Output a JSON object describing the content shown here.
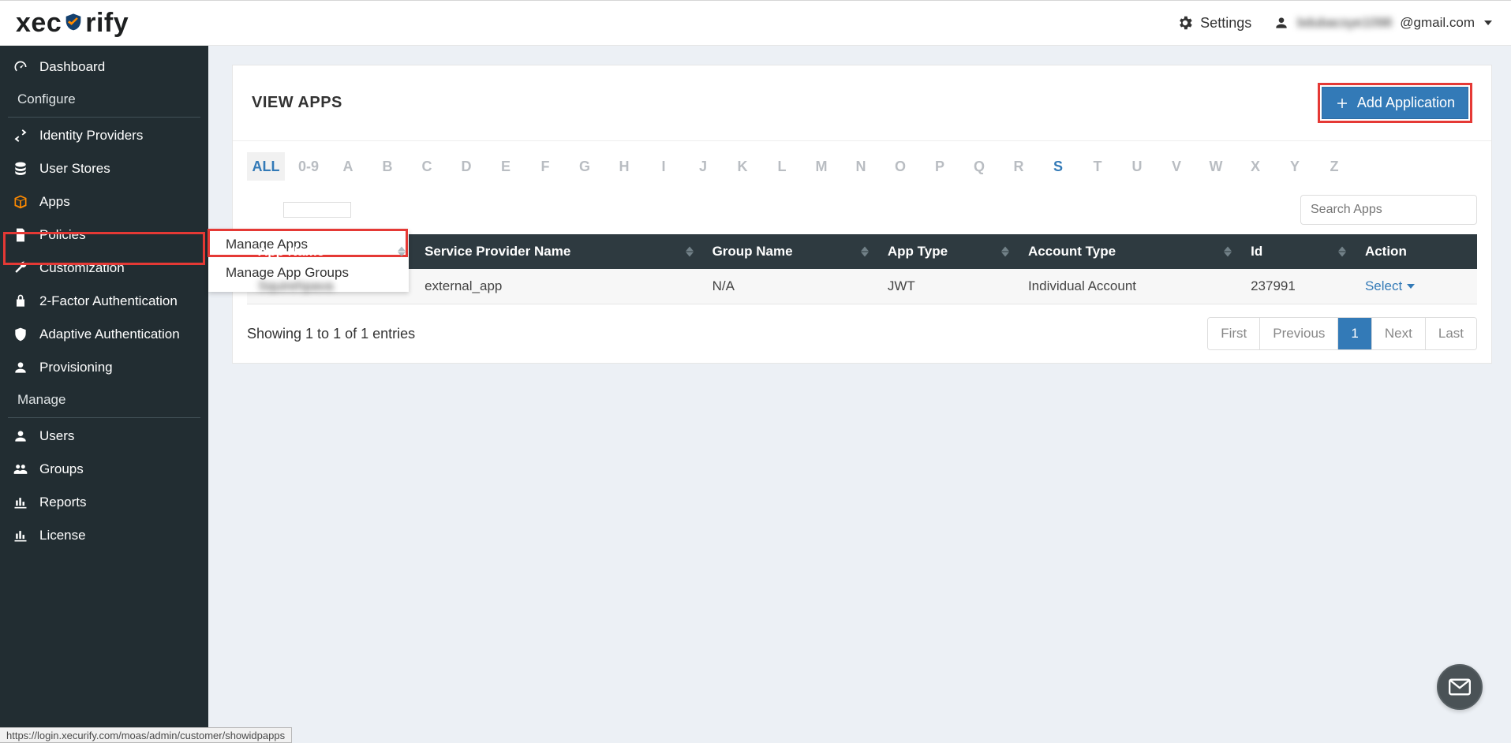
{
  "header": {
    "logo_left": "xec",
    "logo_right": "rify",
    "settings_label": "Settings",
    "user_email_masked": "bdubacsye1098",
    "user_email_suffix": "@gmail.com"
  },
  "sidebar": {
    "items_top": [
      {
        "name": "dashboard",
        "label": "Dashboard",
        "icon": "gauge"
      }
    ],
    "section_configure": "Configure",
    "items_configure": [
      {
        "name": "identity-providers",
        "label": "Identity Providers",
        "icon": "swap"
      },
      {
        "name": "user-stores",
        "label": "User Stores",
        "icon": "db"
      },
      {
        "name": "apps",
        "label": "Apps",
        "icon": "box",
        "active": true
      },
      {
        "name": "policies",
        "label": "Policies",
        "icon": "doc"
      },
      {
        "name": "customization",
        "label": "Customization",
        "icon": "wrench"
      },
      {
        "name": "two-factor",
        "label": "2-Factor Authentication",
        "icon": "lock"
      },
      {
        "name": "adaptive-auth",
        "label": "Adaptive Authentication",
        "icon": "shield"
      },
      {
        "name": "provisioning",
        "label": "Provisioning",
        "icon": "person"
      }
    ],
    "section_manage": "Manage",
    "items_manage": [
      {
        "name": "users",
        "label": "Users",
        "icon": "person"
      },
      {
        "name": "groups",
        "label": "Groups",
        "icon": "group"
      },
      {
        "name": "reports",
        "label": "Reports",
        "icon": "chart"
      },
      {
        "name": "license",
        "label": "License",
        "icon": "chart"
      }
    ],
    "submenu": {
      "manage_apps": "Manage Apps",
      "manage_app_groups": "Manage App Groups"
    }
  },
  "main": {
    "title": "VIEW APPS",
    "add_button": "Add Application",
    "letter_filter": [
      "ALL",
      "0-9",
      "A",
      "B",
      "C",
      "D",
      "E",
      "F",
      "G",
      "H",
      "I",
      "J",
      "K",
      "L",
      "M",
      "N",
      "O",
      "P",
      "Q",
      "R",
      "S",
      "T",
      "U",
      "V",
      "W",
      "X",
      "Y",
      "Z"
    ],
    "letter_selected": "S",
    "search_placeholder": "Search Apps",
    "columns": [
      "App Name",
      "Service Provider Name",
      "Group Name",
      "App Type",
      "Account Type",
      "Id",
      "Action"
    ],
    "rows": [
      {
        "app_name_blur": "Squirehpava",
        "provider": "external_app",
        "group": "N/A",
        "app_type": "JWT",
        "account_type": "Individual Account",
        "id": "237991",
        "action": "Select"
      }
    ],
    "entries_info": "Showing 1 to 1 of 1 entries",
    "pager": {
      "first": "First",
      "previous": "Previous",
      "page": "1",
      "next": "Next",
      "last": "Last"
    }
  },
  "status_bar_url": "https://login.xecurify.com/moas/admin/customer/showidpapps"
}
